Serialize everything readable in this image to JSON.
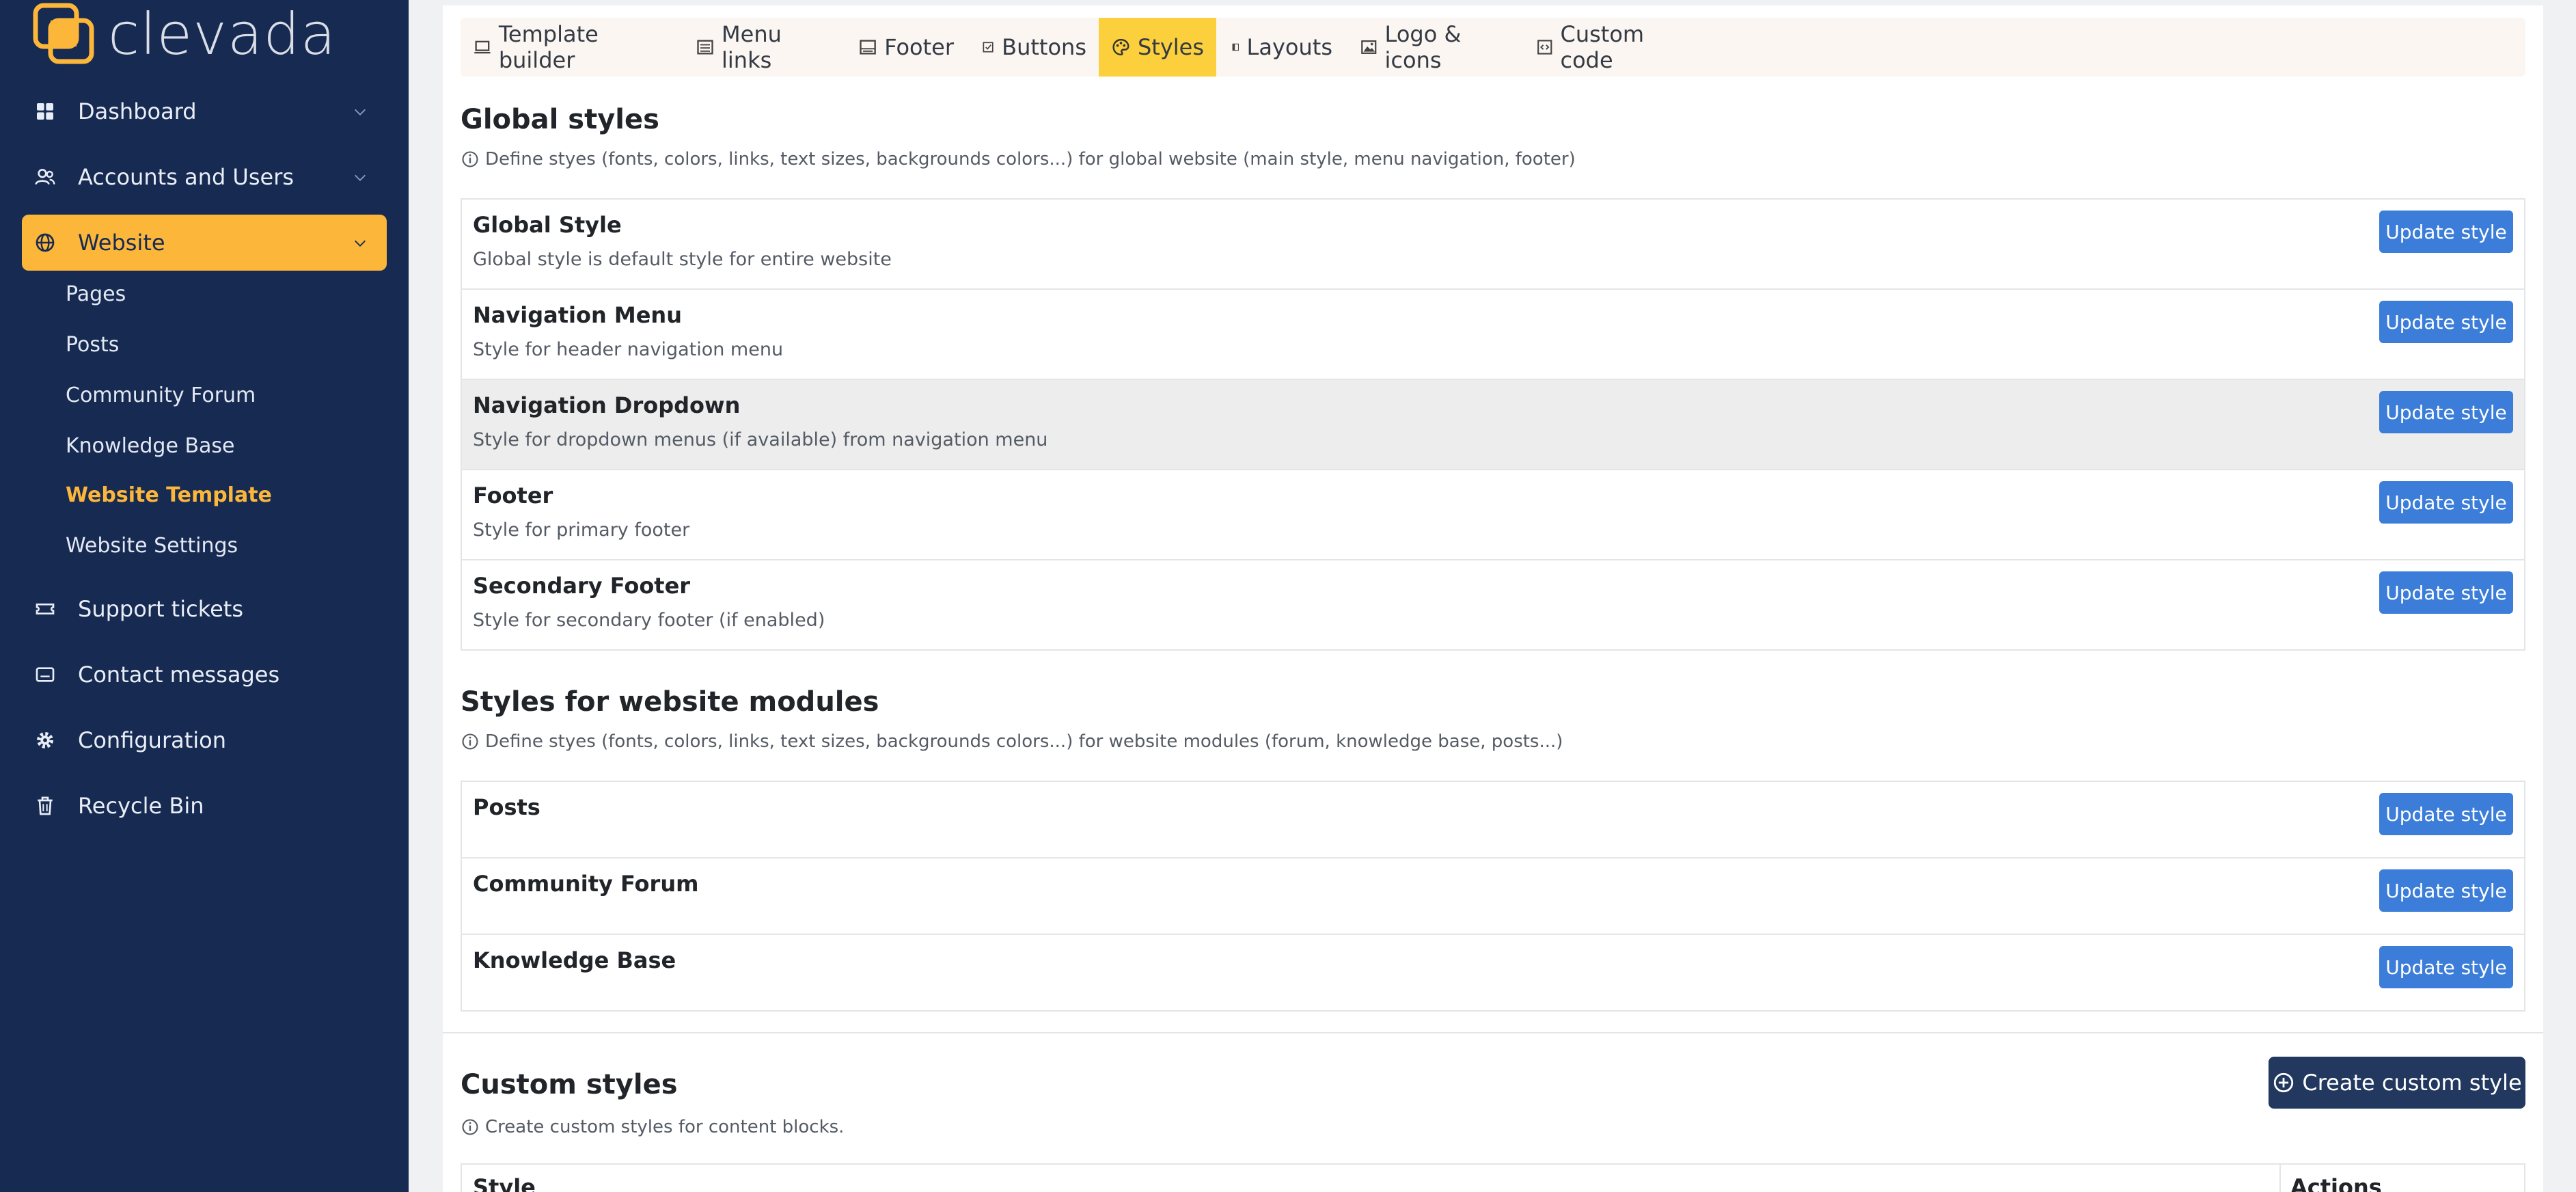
{
  "brand": {
    "name": "clevada"
  },
  "sidebar": {
    "items": [
      {
        "label": "Dashboard"
      },
      {
        "label": "Accounts and Users"
      },
      {
        "label": "Website"
      },
      {
        "label": "Support tickets"
      },
      {
        "label": "Contact messages"
      },
      {
        "label": "Configuration"
      },
      {
        "label": "Recycle Bin"
      }
    ],
    "website_sub": [
      {
        "label": "Pages"
      },
      {
        "label": "Posts"
      },
      {
        "label": "Community Forum"
      },
      {
        "label": "Knowledge Base"
      },
      {
        "label": "Website Template"
      },
      {
        "label": "Website Settings"
      }
    ]
  },
  "tabs": [
    {
      "label": "Template builder"
    },
    {
      "label": "Menu links"
    },
    {
      "label": "Footer"
    },
    {
      "label": "Buttons"
    },
    {
      "label": "Styles"
    },
    {
      "label": "Layouts"
    },
    {
      "label": "Logo & icons"
    },
    {
      "label": "Custom code"
    }
  ],
  "global": {
    "title": "Global styles",
    "desc": "Define styes (fonts, colors, links, text sizes, backgrounds colors...) for global website (main style, menu navigation, footer)",
    "rows": [
      {
        "title": "Global Style",
        "sub": "Global style is default style for entire website",
        "button": "Update style"
      },
      {
        "title": "Navigation Menu",
        "sub": "Style for header navigation menu",
        "button": "Update style"
      },
      {
        "title": "Navigation Dropdown",
        "sub": "Style for dropdown menus (if available) from navigation menu",
        "button": "Update style"
      },
      {
        "title": "Footer",
        "sub": "Style for primary footer",
        "button": "Update style"
      },
      {
        "title": "Secondary Footer",
        "sub": "Style for secondary footer (if enabled)",
        "button": "Update style"
      }
    ]
  },
  "modules": {
    "title": "Styles for website modules",
    "desc": "Define styes (fonts, colors, links, text sizes, backgrounds colors...) for website modules (forum, knowledge base, posts...)",
    "rows": [
      {
        "title": "Posts",
        "button": "Update style"
      },
      {
        "title": "Community Forum",
        "button": "Update style"
      },
      {
        "title": "Knowledge Base",
        "button": "Update style"
      }
    ]
  },
  "custom": {
    "title": "Custom styles",
    "desc": "Create custom styles for content blocks.",
    "create_button": "Create custom style",
    "columns": [
      "Style",
      "Actions"
    ]
  },
  "colors": {
    "sidebar_bg": "#162a52",
    "accent": "#fcb63a",
    "tab_active": "#fcd03c",
    "primary_button": "#3b7dd8",
    "dark_button": "#23385f"
  }
}
